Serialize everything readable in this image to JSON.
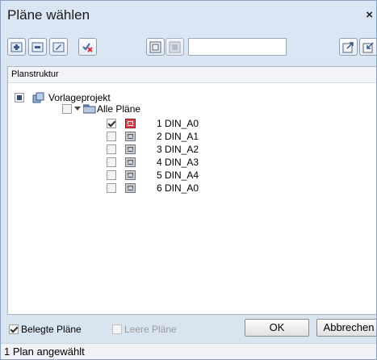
{
  "window": {
    "title": "Pläne wählen",
    "close_glyph": "×"
  },
  "toolbar": {
    "buttons": [
      {
        "icon": "add-plan-icon"
      },
      {
        "icon": "remove-plan-icon"
      },
      {
        "icon": "rename-plan-icon"
      },
      {
        "icon": "uncheck-all-icon"
      },
      {
        "icon": "plan-view-icon"
      },
      {
        "icon": "plan-view-disabled-icon"
      },
      {
        "icon": "export-icon"
      },
      {
        "icon": "import-icon"
      }
    ],
    "search_value": ""
  },
  "tree": {
    "header": "Planstruktur",
    "project": {
      "label": "Vorlageprojekt"
    },
    "folder": {
      "label": "Alle Pläne"
    },
    "plans": [
      {
        "label": "1 DIN_A0",
        "checked": true,
        "active": true
      },
      {
        "label": "2 DIN_A1",
        "checked": false,
        "active": false
      },
      {
        "label": "3 DIN_A2",
        "checked": false,
        "active": false
      },
      {
        "label": "4 DIN_A3",
        "checked": false,
        "active": false
      },
      {
        "label": "5 DIN_A4",
        "checked": false,
        "active": false
      },
      {
        "label": "6 DIN_A0",
        "checked": false,
        "active": false
      }
    ]
  },
  "footer": {
    "belegte_label": "Belegte Pläne",
    "belegte_checked": true,
    "leere_label": "Leere Pläne",
    "leere_checked": false,
    "ok_label": "OK",
    "cancel_label": "Abbrechen"
  },
  "status": {
    "text": "1 Plan angewählt"
  },
  "colors": {
    "accent": "#e8414d",
    "window_bg": "#d9e4f1"
  }
}
